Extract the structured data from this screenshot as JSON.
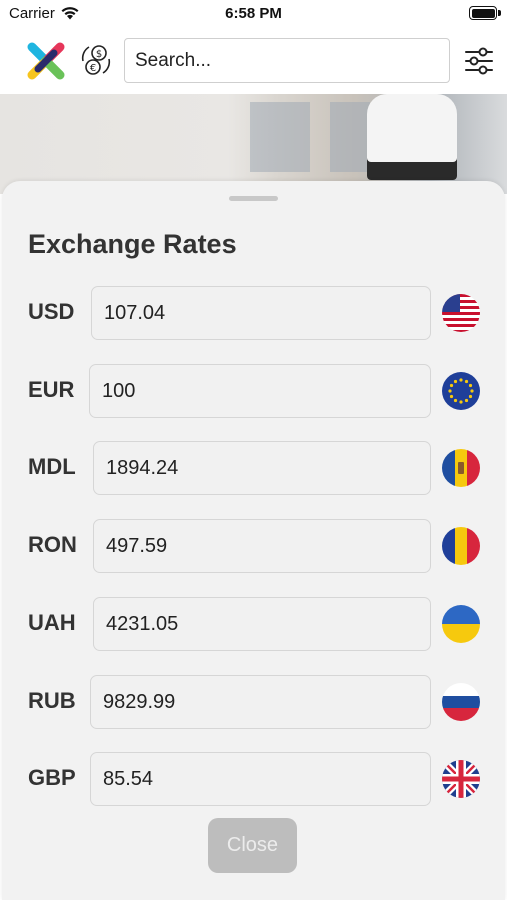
{
  "status_bar": {
    "carrier": "Carrier",
    "time": "6:58 PM"
  },
  "header": {
    "search_placeholder": "Search...",
    "logo_colors": [
      "#1fb5e0",
      "#e6365a",
      "#f7c51e",
      "#6ac259",
      "#2b2b6b"
    ]
  },
  "sheet": {
    "title": "Exchange Rates",
    "rates": [
      {
        "code": "USD",
        "value": "107.04",
        "flag": "us-flag"
      },
      {
        "code": "EUR",
        "value": "100",
        "flag": "eu-flag"
      },
      {
        "code": "MDL",
        "value": "1894.24",
        "flag": "moldova-flag"
      },
      {
        "code": "RON",
        "value": "497.59",
        "flag": "romania-flag"
      },
      {
        "code": "UAH",
        "value": "4231.05",
        "flag": "ukraine-flag"
      },
      {
        "code": "RUB",
        "value": "9829.99",
        "flag": "russia-flag"
      },
      {
        "code": "GBP",
        "value": "85.54",
        "flag": "uk-flag"
      }
    ],
    "close_label": "Close"
  }
}
